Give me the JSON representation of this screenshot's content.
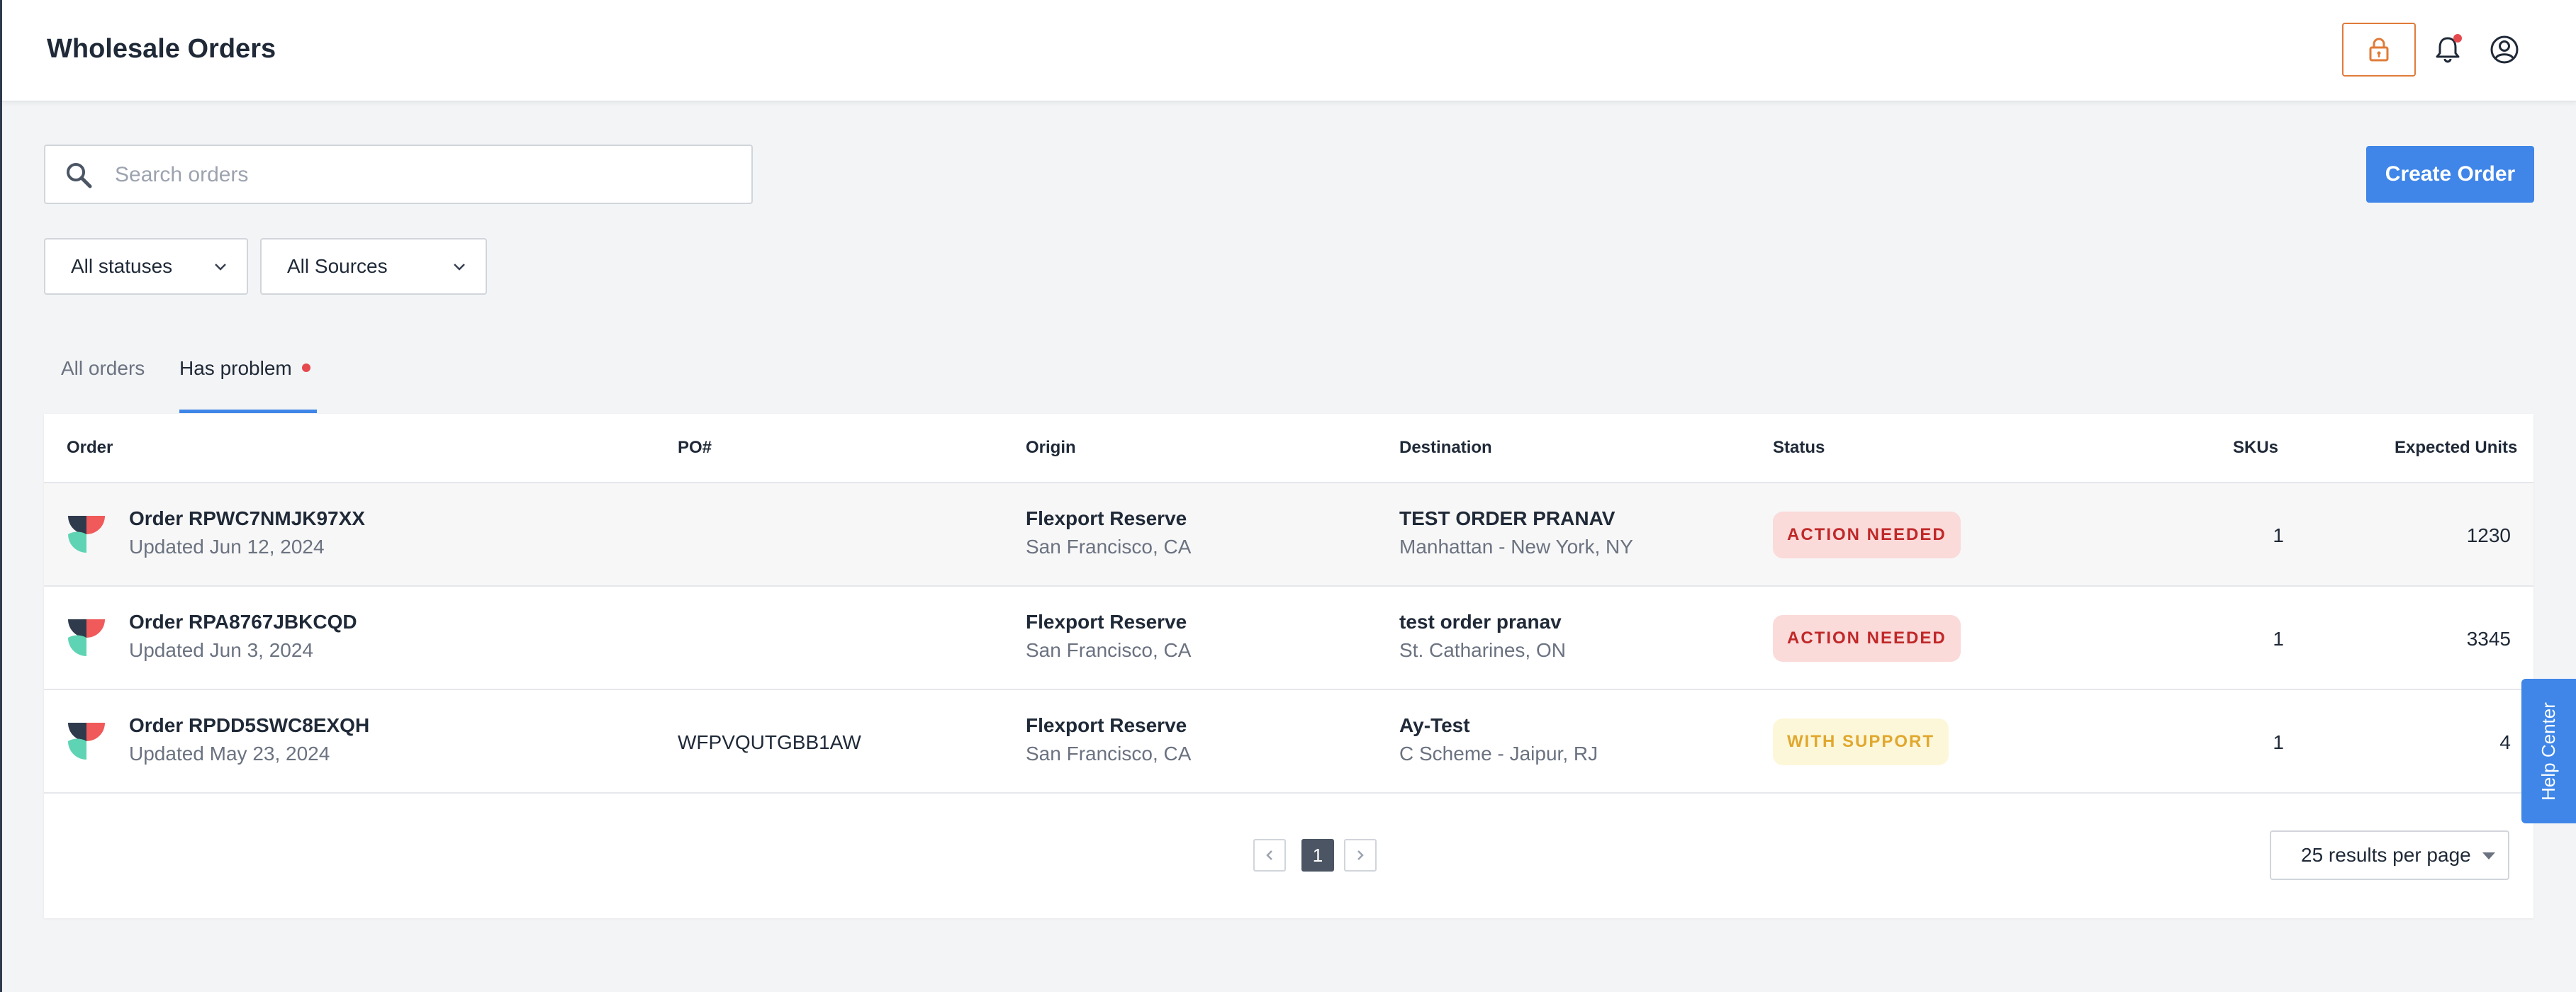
{
  "header": {
    "title": "Wholesale Orders",
    "icons": [
      "lock-icon",
      "bell-icon",
      "user-circle-icon"
    ]
  },
  "search": {
    "placeholder": "Search orders",
    "value": ""
  },
  "create_order_label": "Create Order",
  "filters": {
    "status": "All statuses",
    "source": "All Sources"
  },
  "tabs": [
    {
      "label": "All orders",
      "active": false
    },
    {
      "label": "Has problem",
      "active": true
    }
  ],
  "table": {
    "columns": [
      "Order",
      "PO#",
      "Origin",
      "Destination",
      "Status",
      "SKUs",
      "Expected Units"
    ],
    "rows": [
      {
        "order": "Order RPWC7NMJK97XX",
        "updated": "Updated Jun 12, 2024",
        "po": "",
        "origin_name": "Flexport Reserve",
        "origin_city": "San Francisco, CA",
        "dest_name": "TEST ORDER PRANAV",
        "dest_city": "Manhattan - New York, NY",
        "status": "ACTION NEEDED",
        "skus": "1",
        "units": "1230"
      },
      {
        "order": "Order RPA8767JBKCQD",
        "updated": "Updated Jun 3, 2024",
        "po": "",
        "origin_name": "Flexport Reserve",
        "origin_city": "San Francisco, CA",
        "dest_name": "test order pranav",
        "dest_city": "St. Catharines, ON",
        "status": "ACTION NEEDED",
        "skus": "1",
        "units": "3345"
      },
      {
        "order": "Order RPDD5SWC8EXQH",
        "updated": "Updated May 23, 2024",
        "po": "WFPVQUTGBB1AW",
        "origin_name": "Flexport Reserve",
        "origin_city": "San Francisco, CA",
        "dest_name": "Ay-Test",
        "dest_city": "C Scheme - Jaipur, RJ",
        "status": "WITH SUPPORT",
        "skus": "1",
        "units": "4"
      }
    ]
  },
  "pagination": {
    "current_page": "1",
    "per_page": "25 results per page"
  },
  "help_center": "Help Center",
  "colors": {
    "accent": "#3f86e8",
    "lock_border": "#e07b39",
    "badge_red_bg": "#fbdada",
    "badge_red_text": "#c02828",
    "badge_yellow_bg": "#fdf7d9",
    "badge_yellow_text": "#e0a82e"
  }
}
